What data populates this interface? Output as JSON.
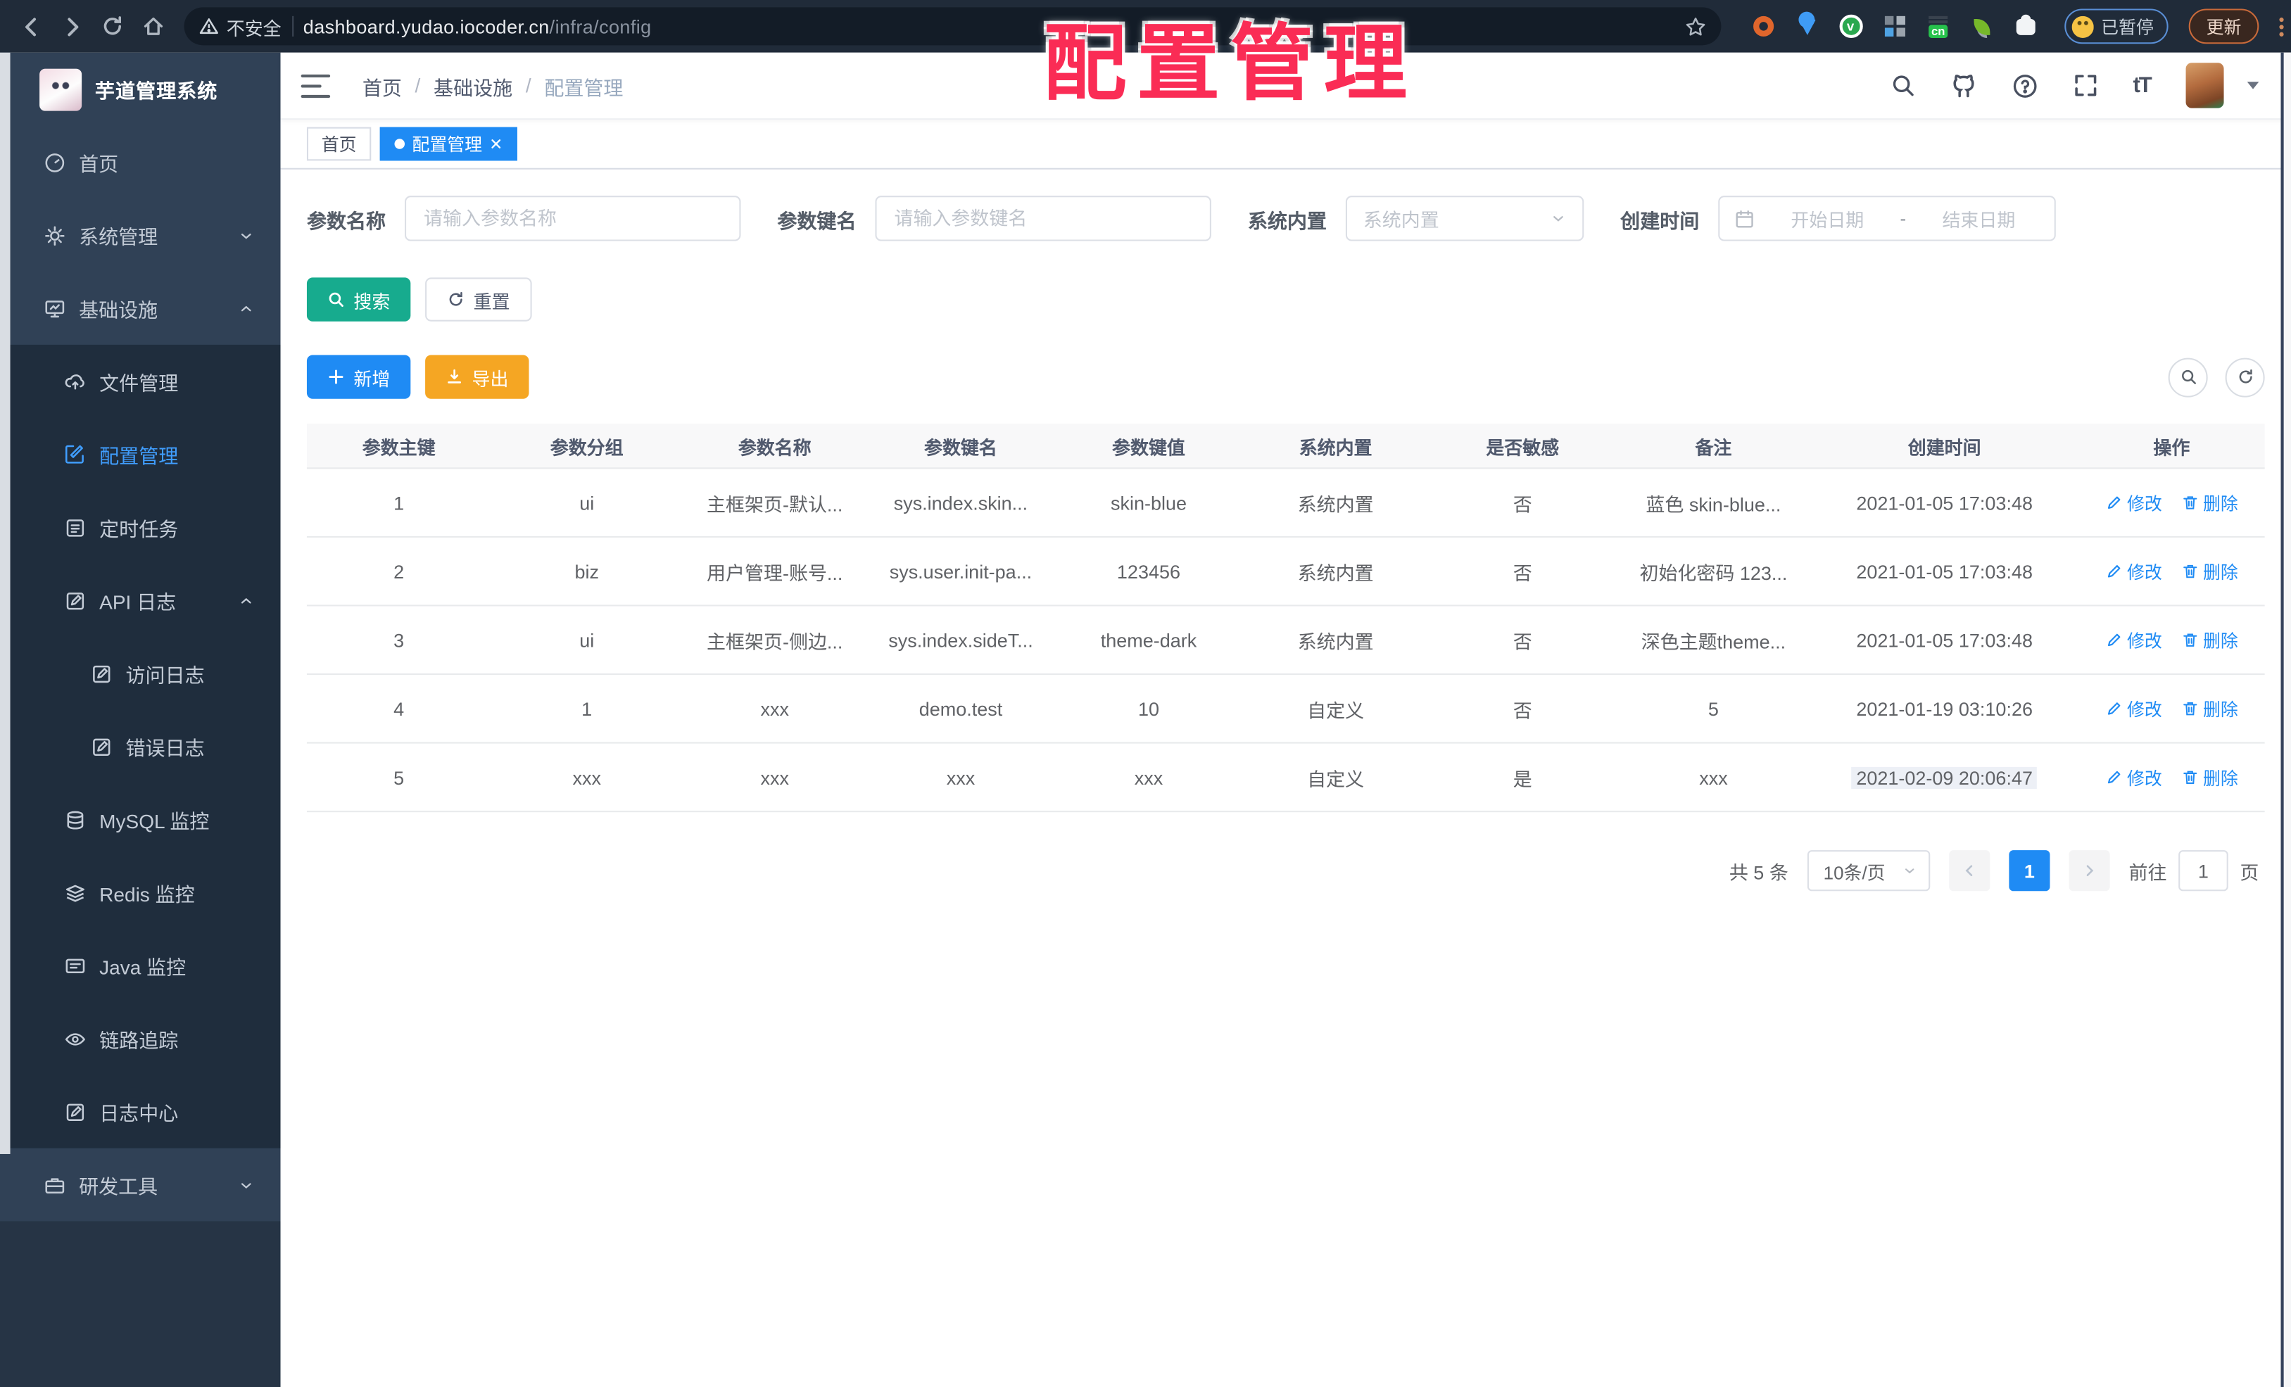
{
  "watermark": "配置管理",
  "browser": {
    "security_label": "不安全",
    "url_host": "dashboard.yudao.iocoder.cn",
    "url_path": "/infra/config",
    "ext_badge": "cn",
    "paused_badge": "已暂停",
    "update_button": "更新"
  },
  "sidebar": {
    "app_title": "芋道管理系统",
    "items": [
      {
        "label": "首页",
        "icon": "dashboard-icon"
      },
      {
        "label": "系统管理",
        "icon": "gear-icon"
      },
      {
        "label": "基础设施",
        "icon": "monitor-icon"
      },
      {
        "label": "文件管理",
        "icon": "cloud-upload-icon"
      },
      {
        "label": "配置管理",
        "icon": "edit-square-icon"
      },
      {
        "label": "定时任务",
        "icon": "task-list-icon"
      },
      {
        "label": "API 日志",
        "icon": "log-icon"
      },
      {
        "label": "访问日志",
        "icon": "log-icon"
      },
      {
        "label": "错误日志",
        "icon": "log-icon"
      },
      {
        "label": "MySQL 监控",
        "icon": "database-icon"
      },
      {
        "label": "Redis 监控",
        "icon": "layers-icon"
      },
      {
        "label": "Java 监控",
        "icon": "screen-icon"
      },
      {
        "label": "链路追踪",
        "icon": "eye-icon"
      },
      {
        "label": "日志中心",
        "icon": "log-icon"
      },
      {
        "label": "研发工具",
        "icon": "toolbox-icon"
      }
    ]
  },
  "header": {
    "breadcrumb": [
      "首页",
      "基础设施",
      "配置管理"
    ],
    "breadcrumb_sep": "/",
    "font_size_label": "tT"
  },
  "tabs": [
    {
      "label": "首页"
    },
    {
      "label": "配置管理"
    }
  ],
  "filters": {
    "name_label": "参数名称",
    "name_placeholder": "请输入参数名称",
    "key_label": "参数键名",
    "key_placeholder": "请输入参数键名",
    "type_label": "系统内置",
    "type_placeholder": "系统内置",
    "date_label": "创建时间",
    "date_start": "开始日期",
    "date_sep": "-",
    "date_end": "结束日期"
  },
  "toolbar": {
    "search": "搜索",
    "reset": "重置",
    "add": "新增",
    "export": "导出"
  },
  "table": {
    "columns": [
      "参数主键",
      "参数分组",
      "参数名称",
      "参数键名",
      "参数键值",
      "系统内置",
      "是否敏感",
      "备注",
      "创建时间",
      "操作"
    ],
    "rows": [
      {
        "cells": [
          "1",
          "ui",
          "主框架页-默认...",
          "sys.index.skin...",
          "skin-blue",
          "系统内置",
          "否",
          "蓝色 skin-blue...",
          "2021-01-05 17:03:48"
        ]
      },
      {
        "cells": [
          "2",
          "biz",
          "用户管理-账号...",
          "sys.user.init-pa...",
          "123456",
          "系统内置",
          "否",
          "初始化密码 123...",
          "2021-01-05 17:03:48"
        ]
      },
      {
        "cells": [
          "3",
          "ui",
          "主框架页-侧边...",
          "sys.index.sideT...",
          "theme-dark",
          "系统内置",
          "否",
          "深色主题theme...",
          "2021-01-05 17:03:48"
        ]
      },
      {
        "cells": [
          "4",
          "1",
          "xxx",
          "demo.test",
          "10",
          "自定义",
          "否",
          "5",
          "2021-01-19 03:10:26"
        ]
      },
      {
        "cells": [
          "5",
          "xxx",
          "xxx",
          "xxx",
          "xxx",
          "自定义",
          "是",
          "xxx",
          "2021-02-09 20:06:47"
        ]
      }
    ],
    "actions": {
      "edit": "修改",
      "delete": "删除"
    }
  },
  "pagination": {
    "total": "共 5 条",
    "page_size": "10条/页",
    "current_page": "1",
    "goto_label": "前往",
    "goto_value": "1",
    "page_unit": "页"
  },
  "colors": {
    "accent": "#1f8bf4",
    "sidebar_bg": "#304156",
    "submenu_bg": "#1f2d3d",
    "teal": "#17ab8e",
    "amber": "#f5a623",
    "watermark": "#fa2c55"
  }
}
